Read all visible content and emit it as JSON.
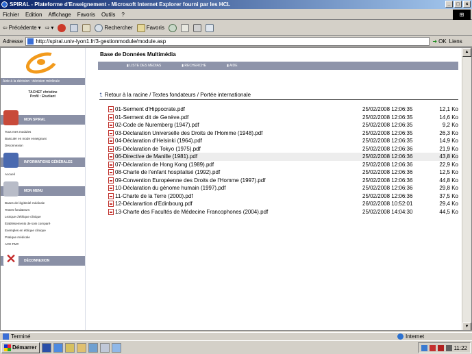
{
  "window": {
    "title": "SPIRAL - Plateforme d'Enseignement - Microsoft Internet Explorer fourni par les HCL",
    "controls": [
      "_",
      "□",
      "×"
    ]
  },
  "menu": [
    "Fichier",
    "Edition",
    "Affichage",
    "Favoris",
    "Outils",
    "?"
  ],
  "toolbar": {
    "back": "Précédente",
    "search": "Rechercher",
    "favorites": "Favoris"
  },
  "address": {
    "label": "Adresse",
    "url": "http://spiral.univ-lyon1.fr/3-gestionmodule/module.asp",
    "ok": "OK",
    "links": "Liens"
  },
  "sidebar": {
    "tagline": "Aide à la décision : décision médicale",
    "user_name": "TACHET christine",
    "user_profile": "Profil : Etudiant",
    "sections": [
      {
        "title": "MON SPIRAL",
        "items": [
          "Tous mes modules",
          "Basculer en mode enseignant",
          "Déconnexion"
        ]
      },
      {
        "title": "INFORMATIONS GÉNÉRALES",
        "items": [
          "Accueil"
        ]
      },
      {
        "title": "MON MENU",
        "items": [
          "Bases de légitimité médicale",
          "Textes fondateurs",
          "Lexique d'éthique clinique",
          "Établissements de soin comparé",
          "Exemples en éthique clinique",
          "Pratique médicale",
          "ACE FMC"
        ]
      },
      {
        "title": "DÉCONNEXION",
        "items": []
      }
    ]
  },
  "content": {
    "title": "Base de Données Multimédia",
    "nav": [
      "LISTE DES MEDIAS",
      "RECHERCHE",
      "AIDE"
    ],
    "breadcrumb": "Retour à la racine / Textes fondateurs / Portée internationale",
    "files": [
      {
        "name": "01-Serment d'Hippocrate.pdf",
        "date": "25/02/2008 12:06:35",
        "size": "12,1 Ko"
      },
      {
        "name": "01-Serment dit de Genève.pdf",
        "date": "25/02/2008 12:06:35",
        "size": "14,6 Ko"
      },
      {
        "name": "02-Code de Nuremberg (1947).pdf",
        "date": "25/02/2008 12:06:35",
        "size": "9,2 Ko"
      },
      {
        "name": "03-Déclaration Universelle des Droits de l'Homme (1948).pdf",
        "date": "25/02/2008 12:06:35",
        "size": "26,3 Ko"
      },
      {
        "name": "04-Déclaration d'Helsinki (1964).pdf",
        "date": "25/02/2008 12:06:35",
        "size": "14,9 Ko"
      },
      {
        "name": "05-Déclaration de Tokyo (1975).pdf",
        "date": "25/02/2008 12:06:36",
        "size": "21,9 Ko"
      },
      {
        "name": "06-Directive de Manille (1981).pdf",
        "date": "25/02/2008 12:06:36",
        "size": "43,8 Ko"
      },
      {
        "name": "07-Déclaration de Hong Kong (1989).pdf",
        "date": "25/02/2008 12:06:36",
        "size": "22,9 Ko"
      },
      {
        "name": "08-Charte de l'enfant hospitalisé (1992).pdf",
        "date": "25/02/2008 12:06:36",
        "size": "12,5 Ko"
      },
      {
        "name": "09-Convention Européenne des Droits de l'Homme (1997).pdf",
        "date": "25/02/2008 12:06:36",
        "size": "44,8 Ko"
      },
      {
        "name": "10-Déclaration du génome humain (1997).pdf",
        "date": "25/02/2008 12:06:36",
        "size": "29,8 Ko"
      },
      {
        "name": "11-Charte de la Terre (2000).pdf",
        "date": "25/02/2008 12:06:36",
        "size": "37,5 Ko"
      },
      {
        "name": "12-Déclarartion d'Edinbourg.pdf",
        "date": "26/02/2008 10:52:01",
        "size": "29,4 Ko"
      },
      {
        "name": "13-Charte des Facultés de Médecine Francophones (2004).pdf",
        "date": "25/02/2008 14:04:30",
        "size": "44,5 Ko"
      }
    ]
  },
  "status": {
    "left": "Terminé",
    "zone": "Internet"
  },
  "taskbar": {
    "start": "Démarrer",
    "clock": "11:22"
  }
}
